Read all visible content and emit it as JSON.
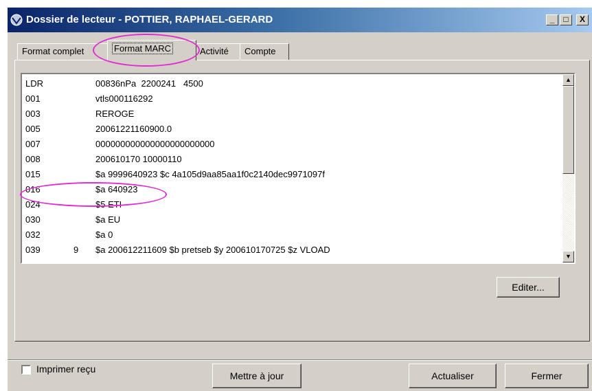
{
  "window": {
    "title": "Dossier de lecteur - POTTIER, RAPHAEL-GERARD",
    "controls": {
      "minimize": "_",
      "maximize": "□",
      "close": "X"
    }
  },
  "tabs": [
    {
      "label": "Format complet",
      "active": false
    },
    {
      "label": "Format MARC",
      "active": true
    },
    {
      "label": "Activité",
      "active": false
    },
    {
      "label": "Compte",
      "active": false
    }
  ],
  "marc_records": [
    {
      "tag": "LDR",
      "ind": "",
      "value": "00836nPa  2200241   4500"
    },
    {
      "tag": "001",
      "ind": "",
      "value": "vtls000116292"
    },
    {
      "tag": "003",
      "ind": "",
      "value": "REROGE"
    },
    {
      "tag": "005",
      "ind": "",
      "value": "20061221160900.0"
    },
    {
      "tag": "007",
      "ind": "",
      "value": "000000000000000000000000"
    },
    {
      "tag": "008",
      "ind": "",
      "value": "200610170 10000110"
    },
    {
      "tag": "015",
      "ind": "",
      "value": "$a 9999640923 $c 4a105d9aa85aa1f0c2140dec9971097f"
    },
    {
      "tag": "016",
      "ind": "",
      "value": "$a 640923"
    },
    {
      "tag": "024",
      "ind": "",
      "value": "$5 ETI"
    },
    {
      "tag": "030",
      "ind": "",
      "value": "$a EU"
    },
    {
      "tag": "032",
      "ind": "",
      "value": "$a 0"
    },
    {
      "tag": "039",
      "ind": "9",
      "value": "$a 200612211609 $b pretseb $y 200610170725 $z VLOAD"
    }
  ],
  "buttons": {
    "edit": "Editer...",
    "update": "Mettre à jour",
    "refresh": "Actualiser",
    "close": "Fermer"
  },
  "print_receipt": {
    "label": "Imprimer reçu",
    "checked": false
  },
  "icons": {
    "scroll_up": "▲",
    "scroll_down": "▼"
  },
  "colors": {
    "highlight": "#e02cd2",
    "title_start": "#0a246a",
    "title_end": "#a6caf0"
  }
}
